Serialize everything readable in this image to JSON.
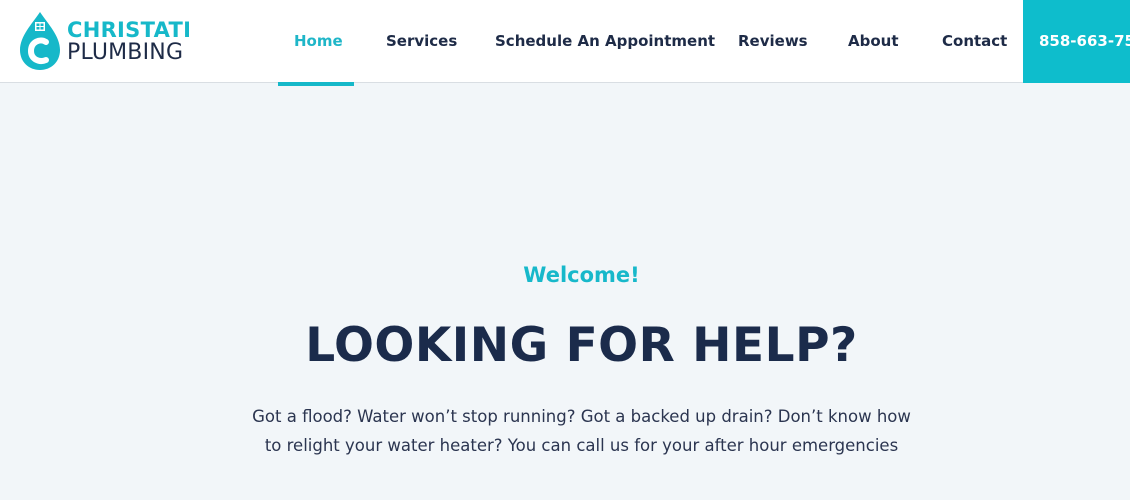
{
  "header": {
    "logo": {
      "line1": "CHRISTATI",
      "line2": "PLUMBING",
      "icon": "water-drop-house-icon",
      "brand_color": "#16b8c9"
    },
    "nav": {
      "items": [
        {
          "label": "Home",
          "active": true
        },
        {
          "label": "Services",
          "active": false
        },
        {
          "label": "Schedule An Appointment",
          "active": false
        },
        {
          "label": "Reviews",
          "active": false
        },
        {
          "label": "About",
          "active": false
        },
        {
          "label": "Contact",
          "active": false
        }
      ]
    },
    "phone_button": {
      "label": "858-663-75",
      "background": "#0ebdcc"
    }
  },
  "hero": {
    "welcome": "Welcome!",
    "headline": "LOOKING FOR HELP?",
    "body": "Got a flood? Water won’t stop running? Got a backed up drain? Don’t know how to relight your water heater? You can call us for your after hour emergencies"
  }
}
